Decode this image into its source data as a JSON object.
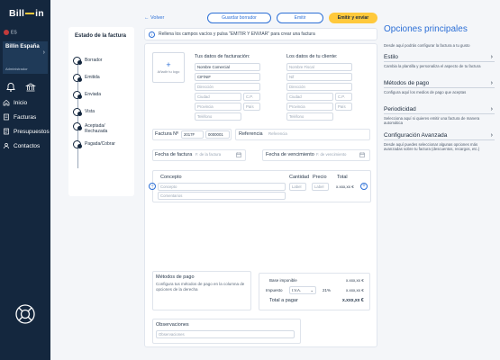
{
  "sidebar": {
    "logo_left": "Bill",
    "logo_right": "in",
    "lang": "ES",
    "company_name": "Billin España",
    "company_role": "Administrador",
    "nav": [
      {
        "label": "Inicio"
      },
      {
        "label": "Facturas"
      },
      {
        "label": "Presupuestos"
      },
      {
        "label": "Contactos"
      }
    ]
  },
  "steps": {
    "title": "Estado de la factura",
    "items": [
      "Borrador",
      "Emitida",
      "Enviada",
      "Vista",
      "Aceptada/ Rechazada",
      "Pagada/Cobrar"
    ]
  },
  "topbar": {
    "back": "← Volver",
    "save_draft": "Guardar borrador",
    "emit": "Emitir",
    "emit_send": "Emitir y enviar"
  },
  "info": {
    "text": "Rellena los campos vacíos y pulsa \"EMITIR Y ENVIAR\" para crear una factura"
  },
  "form": {
    "add_logo": "Añadir tu logo",
    "billing_title": "Tus datos de facturación:",
    "billing_fields": {
      "name": "Nombre Comercial",
      "cif": "CIF/NIF",
      "address": "Dirección",
      "city": "Ciudad",
      "cp": "C.P.",
      "province": "Provincia",
      "country": "País",
      "phone": "Teléfono"
    },
    "client_title": "Los datos de tu cliente:",
    "client_fields": {
      "name": "Nombre Fiscal",
      "nif": "Nif",
      "address": "Dirección",
      "city": "Ciudad",
      "cp": "C.P.",
      "province": "Provincia",
      "country": "País",
      "phone": "Teléfono"
    },
    "invoice_no_label": "Factura Nº",
    "invoice_series": "2017F",
    "invoice_number": "0000001",
    "reference_label": "Referencia",
    "reference_placeholder": "Referencia",
    "invoice_date_label": "Fecha de factura",
    "invoice_date_placeholder": "F. de la factura",
    "due_date_label": "Fecha de vencimiento",
    "due_date_placeholder": "F. de vencimiento",
    "concept_header": "Concepto",
    "concept_placeholder": "Concepto",
    "comments_placeholder": "Comentarios",
    "qty_header": "Cantidad",
    "price_header": "Precio",
    "total_header": "Total",
    "qty_placeholder": "Label",
    "price_placeholder": "Label",
    "row_total": "x.xxx,xx €",
    "payment_title": "Métodos de pago",
    "payment_desc": "Configura tus métodos de pago en la columna de opciones de la derecha",
    "base_label": "Base imponible",
    "base_value": "x.xxx,xx €",
    "tax_label": "Impuesto",
    "tax_type": "I.V.A.",
    "tax_percent": "21%",
    "tax_value": "x.xxx,xx €",
    "total_label": "Total a pagar",
    "total_value": "x.xxx,xx €",
    "obs_title": "Observaciones",
    "obs_placeholder": "Observaciones"
  },
  "right_panel": {
    "title": "Opciones principales",
    "subtitle": "Desde aquí podrás configurar la factura a tu gusto",
    "sections": [
      {
        "title": "Estilo",
        "desc": "Cambia la plantilla y personaliza el aspecto de tu factura"
      },
      {
        "title": "Métodos de pago",
        "desc": "Configura aquí los medios de pago que aceptas"
      },
      {
        "title": "Periodicidad",
        "desc": "Selecciona aquí si quieres emitir una factura de manera automática"
      },
      {
        "title": "Configuración Avanzada",
        "desc": "Desde aquí puedes seleccionar algunas opciones más avanzadas sobre tu factura (descuentos, recargos, etc.)"
      }
    ]
  },
  "colors": {
    "sidebar": "#14273e",
    "accent": "#2c6fd6",
    "yellow": "#ffc93c"
  }
}
